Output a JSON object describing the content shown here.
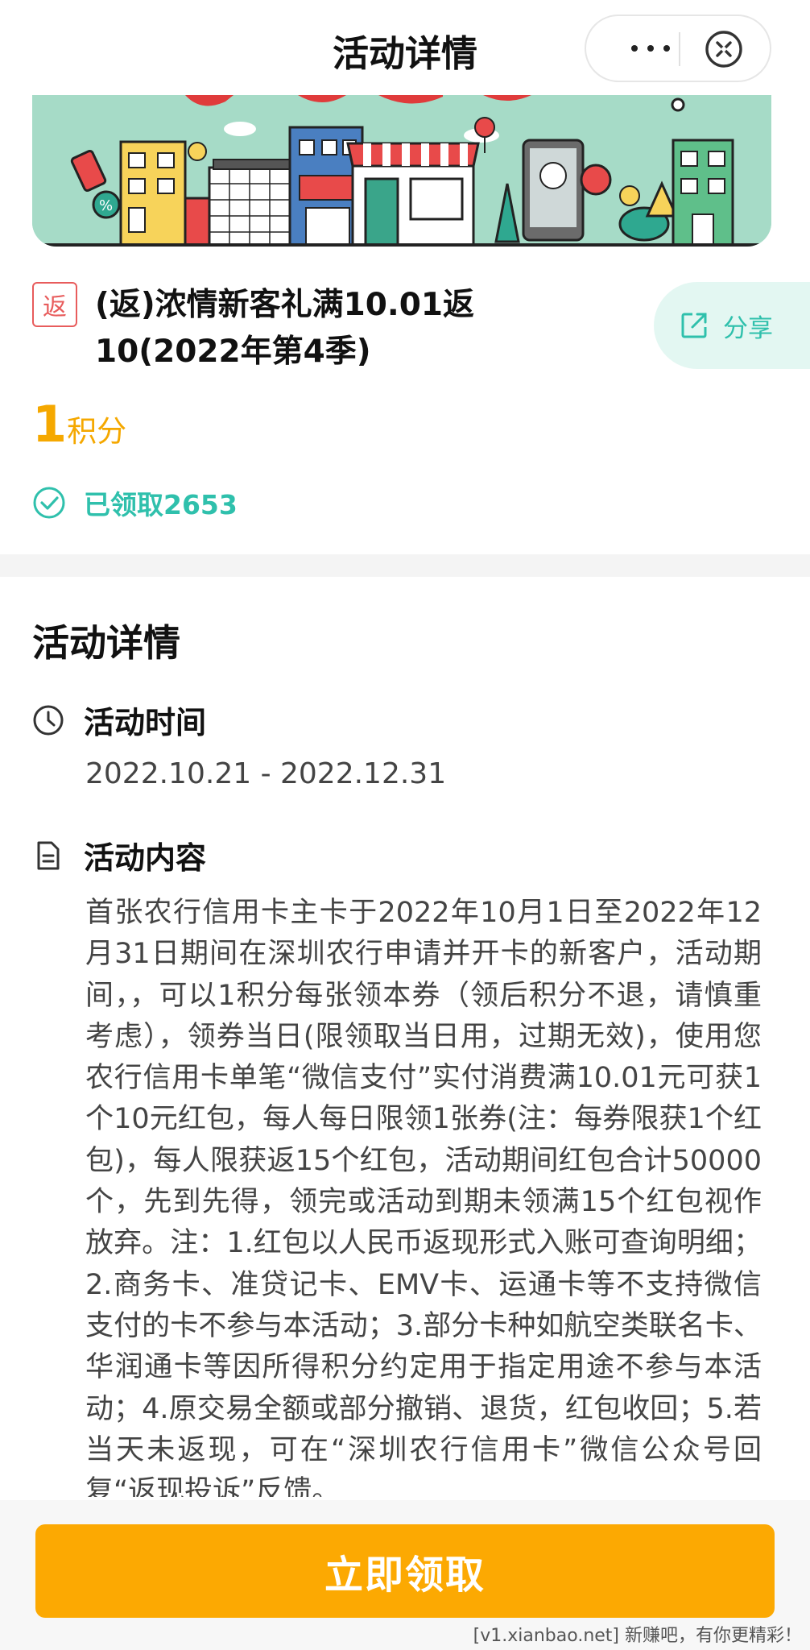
{
  "header": {
    "title": "活动详情"
  },
  "activity": {
    "tag": "返",
    "title": "(返)浓情新客礼满10.01返10(2022年第4季)",
    "share_label": "分享",
    "points_value": "1",
    "points_unit": "积分",
    "claimed_text": "已领取2653"
  },
  "details": {
    "section_title": "活动详情",
    "time_label": "活动时间",
    "time_value": "2022.10.21 - 2022.12.31",
    "content_label": "活动内容",
    "content_text": "首张农行信用卡主卡于2022年10月1日至2022年12月31日期间在深圳农行申请并开卡的新客户，活动期间，，可以1积分每张领本券（领后积分不退，请慎重考虑），领券当日(限领取当日用，过期无效)，使用您农行信用卡单笔“微信支付”实付消费满10.01元可获1个10元红包，每人每日限领1张券(注：每券限获1个红包)，每人限获返15个红包，活动期间红包合计50000个，先到先得，领完或活动到期未领满15个红包视作放弃。注：1.红包以人民币返现形式入账可查询明细；2.商务卡、准贷记卡、EMV卡、运通卡等不支持微信支付的卡不参与本活动；3.部分卡种如航空类联名卡、华润通卡等因所得积分约定用于指定用途不参与本活动；4.原交易全额或部分撤销、退货，红包收回；5.若当天未返现，可在“深圳农行信用卡”微信公众号回复“返现投诉”反馈。"
  },
  "action": {
    "claim_label": "立即领取"
  },
  "watermark": "[v1.xianbao.net] 新赚吧，有你更精彩！",
  "colors": {
    "accent_teal": "#2fc0ac",
    "points_orange": "#f5a800",
    "button_orange": "#fca902",
    "tag_red": "#e85c5c"
  }
}
